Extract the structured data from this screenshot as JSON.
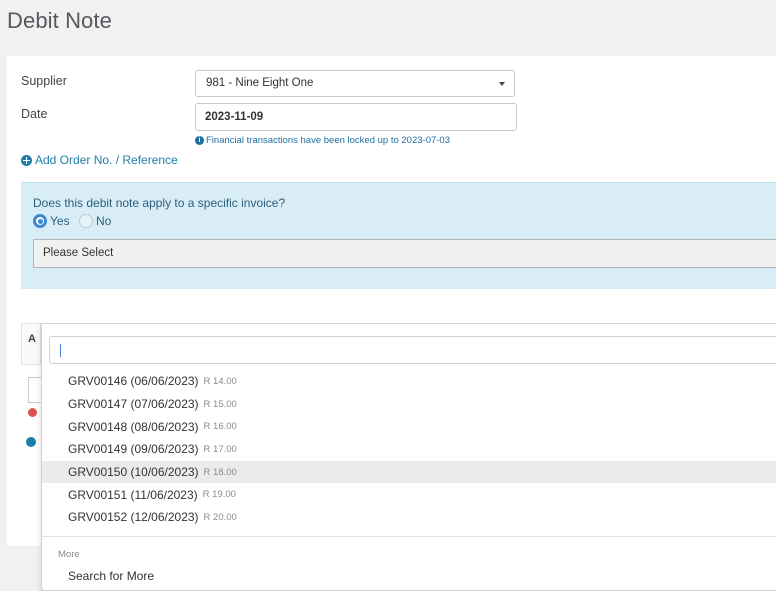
{
  "page": {
    "title": "Debit Note"
  },
  "form": {
    "supplier_label": "Supplier",
    "supplier_value": "981 - Nine Eight One",
    "date_label": "Date",
    "date_value": "2023-11-09",
    "lock_note": "Financial transactions have been locked up to 2023-07-03",
    "add_reference_label": "Add Order No. / Reference"
  },
  "invoice": {
    "question": "Does this debit note apply to a specific invoice?",
    "yes_label": "Yes",
    "no_label": "No",
    "selected": "Yes",
    "select_value": "Please Select"
  },
  "background": {
    "table_header_partial": "A"
  },
  "dropdown": {
    "search_value": "",
    "items": [
      {
        "code": "GRV00146 (06/06/2023)",
        "amount": "R 14.00"
      },
      {
        "code": "GRV00147 (07/06/2023)",
        "amount": "R 15.00"
      },
      {
        "code": "GRV00148 (08/06/2023)",
        "amount": "R 16.00"
      },
      {
        "code": "GRV00149 (09/06/2023)",
        "amount": "R 17.00"
      },
      {
        "code": "GRV00150 (10/06/2023)",
        "amount": "R 18.00"
      },
      {
        "code": "GRV00151 (11/06/2023)",
        "amount": "R 19.00"
      },
      {
        "code": "GRV00152 (12/06/2023)",
        "amount": "R 20.00"
      }
    ],
    "hovered_index": 4,
    "more_group_label": "More",
    "more_action": "Search for More"
  },
  "colors": {
    "accent": "#1e7ea9",
    "panel_bg": "#d9edf6",
    "radio_on": "#3b8bd0",
    "danger": "#d9534f"
  }
}
